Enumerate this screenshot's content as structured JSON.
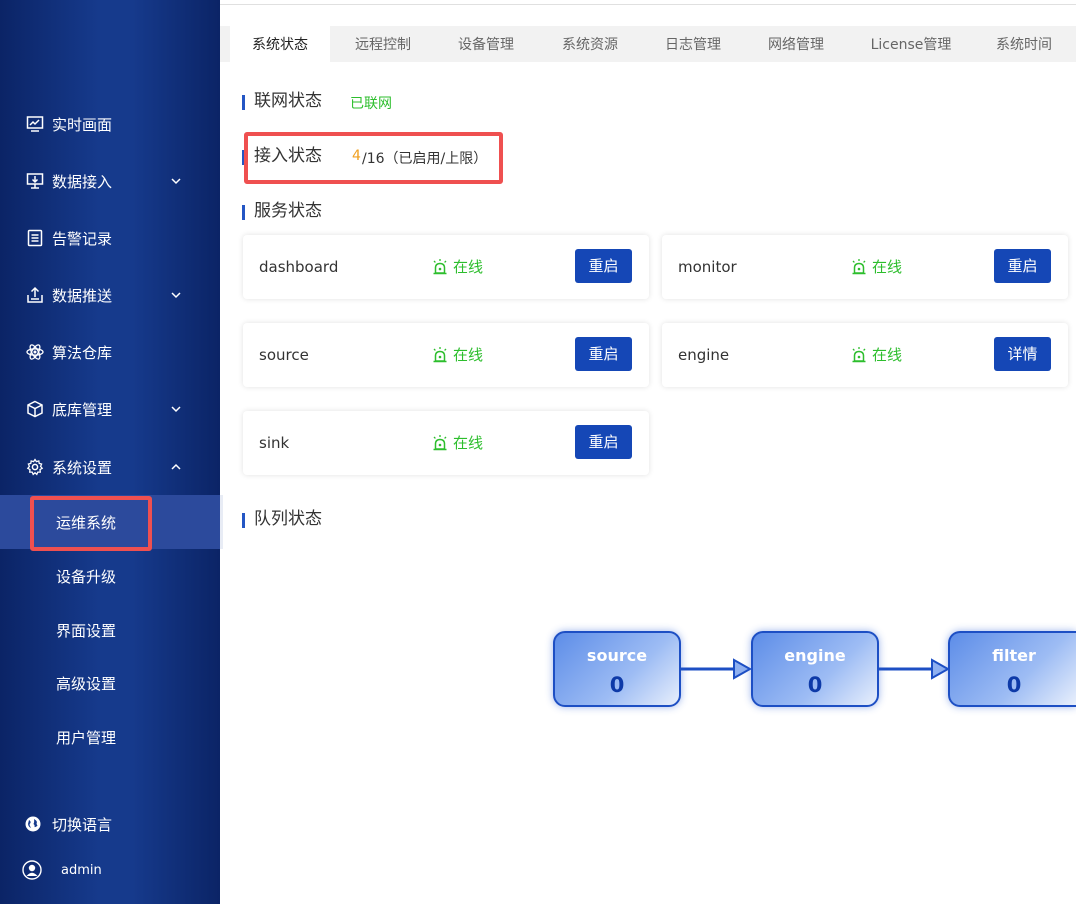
{
  "sidebar": {
    "items": [
      {
        "label": "实时画面",
        "icon": "monitor-chart-icon"
      },
      {
        "label": "数据接入",
        "icon": "data-input-icon"
      },
      {
        "label": "告警记录",
        "icon": "document-icon"
      },
      {
        "label": "数据推送",
        "icon": "upload-icon"
      },
      {
        "label": "算法仓库",
        "icon": "atom-icon"
      },
      {
        "label": "底库管理",
        "icon": "cube-icon"
      },
      {
        "label": "系统设置",
        "icon": "gear-icon"
      }
    ],
    "subitems": [
      "运维系统",
      "设备升级",
      "界面设置",
      "高级设置",
      "用户管理"
    ],
    "language": "切换语言",
    "user": "admin"
  },
  "tabs": [
    "系统状态",
    "远程控制",
    "设备管理",
    "系统资源",
    "日志管理",
    "网络管理",
    "License管理",
    "系统时间"
  ],
  "network": {
    "title": "联网状态",
    "value": "已联网"
  },
  "access": {
    "title": "接入状态",
    "used": "4",
    "rest": "/16（已启用/上限）"
  },
  "services": {
    "title": "服务状态",
    "status_label": "在线",
    "items": [
      {
        "name": "dashboard",
        "button": "重启"
      },
      {
        "name": "monitor",
        "button": "重启"
      },
      {
        "name": "source",
        "button": "重启"
      },
      {
        "name": "engine",
        "button": "详情"
      },
      {
        "name": "sink",
        "button": "重启"
      }
    ]
  },
  "queue": {
    "title": "队列状态",
    "nodes": [
      {
        "name": "source",
        "value": "0"
      },
      {
        "name": "engine",
        "value": "0"
      },
      {
        "name": "filter",
        "value": "0"
      }
    ]
  },
  "colors": {
    "sidebar": "#163a8c",
    "accent": "#1547b6",
    "online": "#2dbe2d",
    "warning": "#f0a020",
    "highlight": "#ef5050"
  }
}
